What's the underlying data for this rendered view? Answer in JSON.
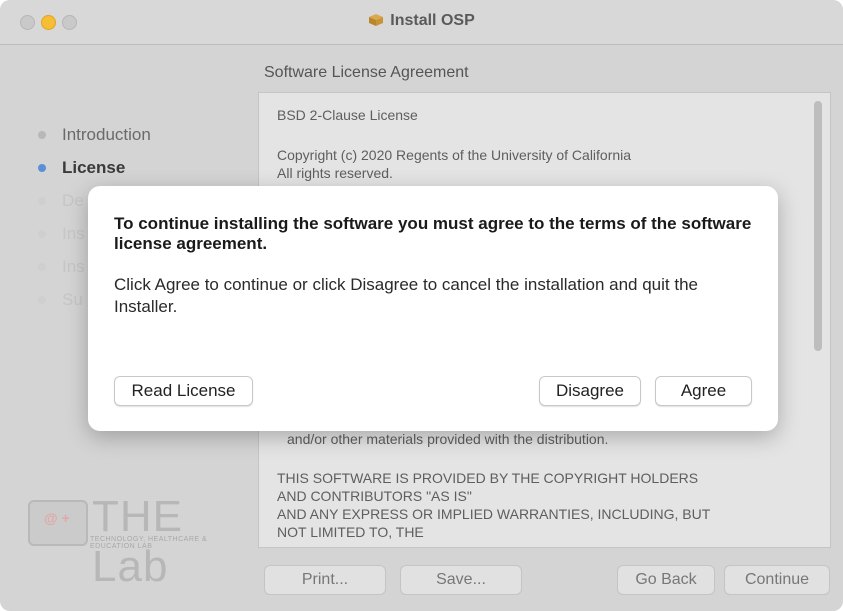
{
  "window": {
    "title": "Install OSP",
    "subtitle": "Software License Agreement"
  },
  "steps": [
    {
      "label": "Introduction"
    },
    {
      "label": "License"
    },
    {
      "label": "De"
    },
    {
      "label": "Ins"
    },
    {
      "label": "Ins"
    },
    {
      "label": "Su"
    }
  ],
  "logo": {
    "text": "THE Lab",
    "tagline": "TECHNOLOGY, HEALTHCARE & EDUCATION LAB",
    "symbol": "@ +"
  },
  "license": {
    "lines": [
      "BSD 2-Clause License",
      "Copyright (c) 2020 Regents of the University of California",
      "All rights reserved.",
      "and/or other materials provided with the distribution.",
      "THIS SOFTWARE IS PROVIDED BY THE COPYRIGHT HOLDERS",
      "AND CONTRIBUTORS \"AS IS\"",
      "AND ANY EXPRESS OR IMPLIED WARRANTIES, INCLUDING, BUT",
      "NOT LIMITED TO, THE"
    ]
  },
  "footer": {
    "print": "Print...",
    "save": "Save...",
    "go_back": "Go Back",
    "continue": "Continue"
  },
  "dialog": {
    "title": "To continue installing the software you must agree to the terms of the software license agreement.",
    "body": "Click Agree to continue or click Disagree to cancel the installation and quit the Installer.",
    "read_license": "Read License",
    "disagree": "Disagree",
    "agree": "Agree"
  }
}
